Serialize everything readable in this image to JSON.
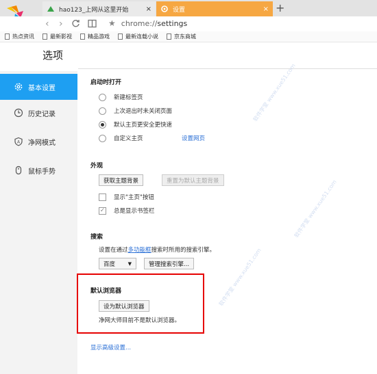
{
  "browser": {
    "tabs": [
      {
        "label": "hao123_上网从这里开始",
        "close": "×",
        "active": false
      },
      {
        "label": "设置",
        "close": "×",
        "active": true
      }
    ],
    "new_tab": "+",
    "address": {
      "scheme": "chrome://",
      "host": "settings"
    },
    "bookmarks": [
      "热点资讯",
      "最新影视",
      "精品游戏",
      "最新连载小说",
      "京东商城"
    ]
  },
  "page": {
    "title": "选项"
  },
  "sidebar": {
    "items": [
      {
        "label": "基本设置",
        "active": true
      },
      {
        "label": "历史记录",
        "active": false
      },
      {
        "label": "净网模式",
        "active": false
      },
      {
        "label": "鼠标手势",
        "active": false
      }
    ]
  },
  "startup": {
    "title": "启动时打开",
    "options": [
      "新建标签页",
      "上次退出时未关闭页面",
      "默认主页更安全更快速",
      "自定义主页"
    ],
    "selected_index": 2,
    "set_pages_link": "设置网页"
  },
  "appearance": {
    "title": "外观",
    "get_theme_button": "获取主题背景",
    "reset_theme_button": "重置为默认主题背景",
    "show_home_label": "显示\"主页\"按钮",
    "show_home_checked": false,
    "bookmarks_bar_label": "总是显示书签栏",
    "bookmarks_bar_checked": true
  },
  "search": {
    "title": "搜索",
    "desc_before": "设置在通过",
    "desc_link": "多功能框",
    "desc_after": "搜索时所用的搜索引擎。",
    "engine": "百度",
    "manage_button": "管理搜索引擎..."
  },
  "default_browser": {
    "title": "默认浏览器",
    "set_button": "设为默认浏览器",
    "status": "净网大师目前不是默认浏览器。"
  },
  "advanced_link": "显示高级设置...",
  "watermark": "软件学堂 www.xue51.com",
  "colors": {
    "accent": "#1e9ff2",
    "tab_active": "#f6a742",
    "highlight": "#e60000",
    "link": "#2a6fd6"
  }
}
